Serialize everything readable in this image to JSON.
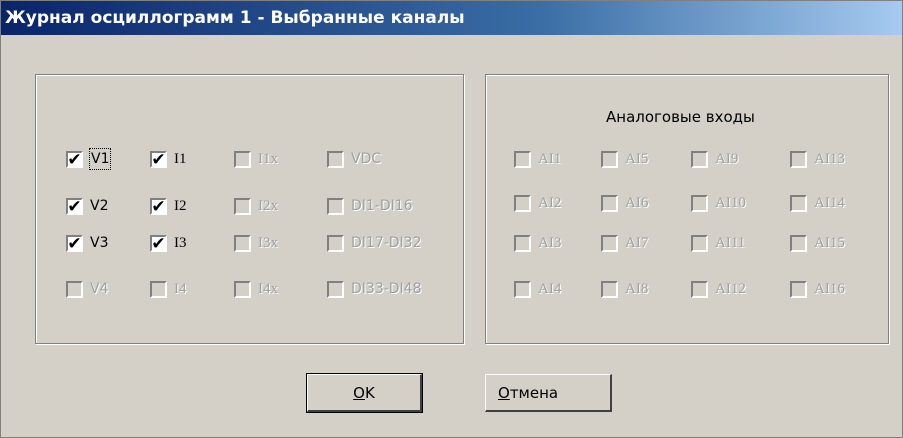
{
  "window": {
    "title": "Журнал осциллограмм 1 - Выбранные каналы"
  },
  "left_group": {
    "channels": [
      {
        "label": "V1",
        "checked": true,
        "enabled": true,
        "focused": true
      },
      {
        "label": "I1",
        "checked": true,
        "enabled": true
      },
      {
        "label": "I1x",
        "checked": false,
        "enabled": false
      },
      {
        "label": "VDC",
        "checked": false,
        "enabled": false
      },
      {
        "label": "V2",
        "checked": true,
        "enabled": true
      },
      {
        "label": "I2",
        "checked": true,
        "enabled": true
      },
      {
        "label": "I2x",
        "checked": false,
        "enabled": false
      },
      {
        "label": "DI1-DI16",
        "checked": false,
        "enabled": false
      },
      {
        "label": "V3",
        "checked": true,
        "enabled": true
      },
      {
        "label": "I3",
        "checked": true,
        "enabled": true
      },
      {
        "label": "I3x",
        "checked": false,
        "enabled": false
      },
      {
        "label": "DI17-DI32",
        "checked": false,
        "enabled": false
      },
      {
        "label": "V4",
        "checked": false,
        "enabled": false
      },
      {
        "label": "I4",
        "checked": false,
        "enabled": false
      },
      {
        "label": "I4x",
        "checked": false,
        "enabled": false
      },
      {
        "label": "DI33-DI48",
        "checked": false,
        "enabled": false
      }
    ]
  },
  "right_group": {
    "title": "Аналоговые входы",
    "channels": [
      {
        "label": "AI1",
        "checked": false,
        "enabled": false
      },
      {
        "label": "AI5",
        "checked": false,
        "enabled": false
      },
      {
        "label": "AI9",
        "checked": false,
        "enabled": false
      },
      {
        "label": "AI13",
        "checked": false,
        "enabled": false
      },
      {
        "label": "AI2",
        "checked": false,
        "enabled": false
      },
      {
        "label": "AI6",
        "checked": false,
        "enabled": false
      },
      {
        "label": "AI10",
        "checked": false,
        "enabled": false
      },
      {
        "label": "AI14",
        "checked": false,
        "enabled": false
      },
      {
        "label": "AI3",
        "checked": false,
        "enabled": false
      },
      {
        "label": "AI7",
        "checked": false,
        "enabled": false
      },
      {
        "label": "AI11",
        "checked": false,
        "enabled": false
      },
      {
        "label": "AI15",
        "checked": false,
        "enabled": false
      },
      {
        "label": "AI4",
        "checked": false,
        "enabled": false
      },
      {
        "label": "AI8",
        "checked": false,
        "enabled": false
      },
      {
        "label": "AI12",
        "checked": false,
        "enabled": false
      },
      {
        "label": "AI16",
        "checked": false,
        "enabled": false
      }
    ]
  },
  "buttons": {
    "ok": {
      "accel": "O",
      "rest": "K"
    },
    "cancel": {
      "accel": "О",
      "rest": "тмена"
    }
  }
}
